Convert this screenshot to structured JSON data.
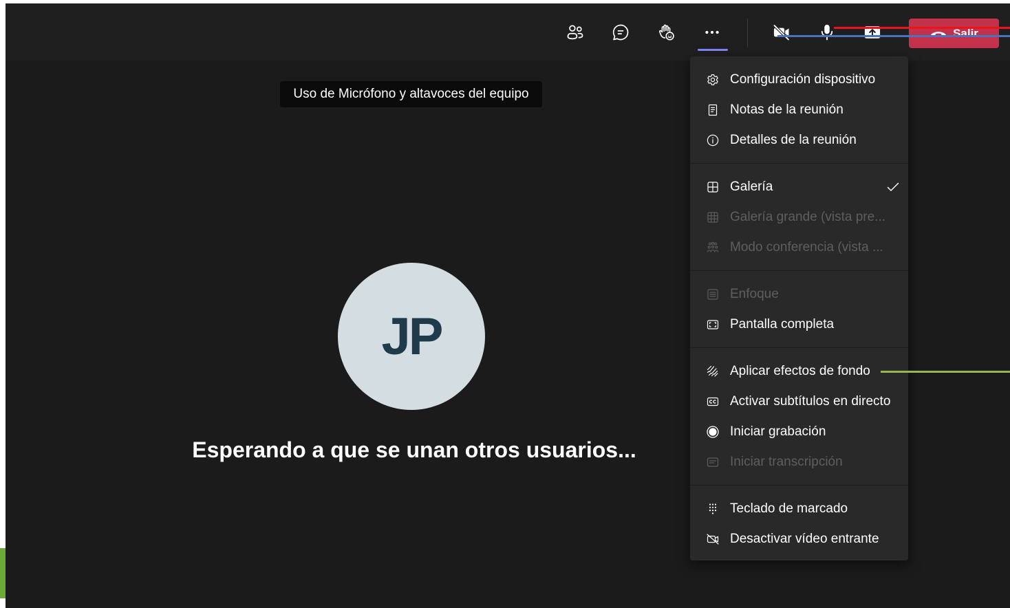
{
  "colors": {
    "stage_background": "#1b1b1b",
    "toolbar_background": "#1f1f1f",
    "menu_background": "#292929",
    "menu_divider": "#1c1c1c",
    "accent_indicator": "#7f85f5",
    "leave_button": "#c4314b",
    "avatar_background": "#d3dde2",
    "avatar_text": "#1e3a4b",
    "disabled_text": "#5e5e5e",
    "tooltip_background": "#0a0a0a"
  },
  "toolbar": {
    "controls": [
      {
        "icon": "people-icon"
      },
      {
        "icon": "chat-icon"
      },
      {
        "icon": "raise-hand-react-icon"
      },
      {
        "icon": "more-options-icon",
        "active": true
      },
      {
        "icon": "camera-off-icon"
      },
      {
        "icon": "microphone-icon"
      },
      {
        "icon": "share-screen-icon"
      }
    ],
    "leave": {
      "icon": "phone-hangup-icon",
      "label": "Salir"
    }
  },
  "tooltip": {
    "text": "Uso de Micrófono y altavoces del equipo"
  },
  "stage": {
    "avatar_initials": "JP",
    "waiting_message": "Esperando a que se unan otros usuarios..."
  },
  "more_menu": {
    "sections": [
      {
        "items": [
          {
            "label": "Configuración dispositivo",
            "icon": "gear-icon",
            "enabled": true
          },
          {
            "label": "Notas de la reunión",
            "icon": "notes-icon",
            "enabled": true
          },
          {
            "label": "Detalles de la reunión",
            "icon": "info-icon",
            "enabled": true
          }
        ]
      },
      {
        "items": [
          {
            "label": "Galería",
            "icon": "gallery-grid-icon",
            "enabled": true,
            "checked": true
          },
          {
            "label": "Galería grande (vista pre...",
            "icon": "large-gallery-icon",
            "enabled": false
          },
          {
            "label": "Modo conferencia (vista ...",
            "icon": "together-mode-icon",
            "enabled": false
          }
        ]
      },
      {
        "items": [
          {
            "label": "Enfoque",
            "icon": "focus-icon",
            "enabled": false
          },
          {
            "label": "Pantalla completa",
            "icon": "fullscreen-icon",
            "enabled": true
          }
        ]
      },
      {
        "items": [
          {
            "label": "Aplicar efectos de fondo",
            "icon": "background-effects-icon",
            "enabled": true
          },
          {
            "label": "Activar subtítulos en directo",
            "icon": "closed-captions-icon",
            "enabled": true
          },
          {
            "label": "Iniciar grabación",
            "icon": "record-icon",
            "enabled": true
          },
          {
            "label": "Iniciar transcripción",
            "icon": "transcription-icon",
            "enabled": false
          }
        ]
      },
      {
        "items": [
          {
            "label": "Teclado de marcado",
            "icon": "dialpad-icon",
            "enabled": true
          },
          {
            "label": "Desactivar vídeo entrante",
            "icon": "video-off-icon",
            "enabled": true
          }
        ]
      }
    ]
  },
  "annotations": {
    "red_line": "#e8151c",
    "blue_line": "#4a72c0",
    "green_line": "#92b84e",
    "left_marker": "#6aab38"
  }
}
